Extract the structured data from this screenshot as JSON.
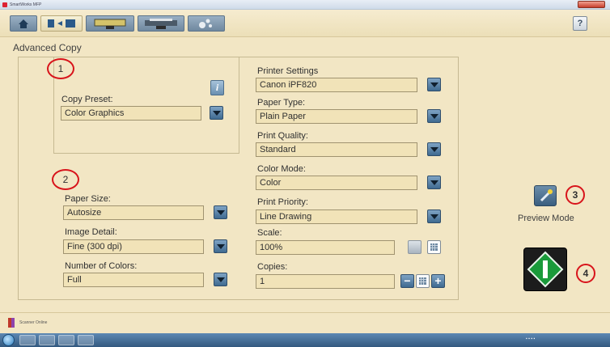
{
  "window": {
    "title": "SmartWorks MFP"
  },
  "page_title": "Advanced Copy",
  "toolbar": {
    "items": [
      "home-icon",
      "copy-mode-icon",
      "scan-to-file-icon",
      "scan-to-print-icon",
      "settings-icon"
    ],
    "help_label": "?"
  },
  "section1": {
    "marker": "1",
    "copy_preset_label": "Copy Preset:",
    "copy_preset_value": "Color Graphics",
    "info_label": "i"
  },
  "section2": {
    "marker": "2",
    "paper_size_label": "Paper Size:",
    "paper_size_value": "Autosize",
    "image_detail_label": "Image Detail:",
    "image_detail_value": "Fine (300 dpi)",
    "num_colors_label": "Number of Colors:",
    "num_colors_value": "Full"
  },
  "printer": {
    "settings_label": "Printer Settings",
    "printer_value": "Canon iPF820",
    "paper_type_label": "Paper Type:",
    "paper_type_value": "Plain Paper",
    "print_quality_label": "Print Quality:",
    "print_quality_value": "Standard",
    "color_mode_label": "Color Mode:",
    "color_mode_value": "Color",
    "print_priority_label": "Print Priority:",
    "print_priority_value": "Line Drawing",
    "scale_label": "Scale:",
    "scale_value": "100%",
    "copies_label": "Copies:",
    "copies_value": "1",
    "minus_label": "−",
    "plus_label": "+"
  },
  "preview": {
    "marker": "3",
    "label": "Preview Mode"
  },
  "start": {
    "marker": "4"
  },
  "statusbar": {
    "text": "Scanner Online"
  },
  "colors": {
    "accent_red": "#d8141b",
    "start_green": "#1a9a3a",
    "dropdown_blue": "#3f6a90",
    "background": "#f2e6c4"
  }
}
